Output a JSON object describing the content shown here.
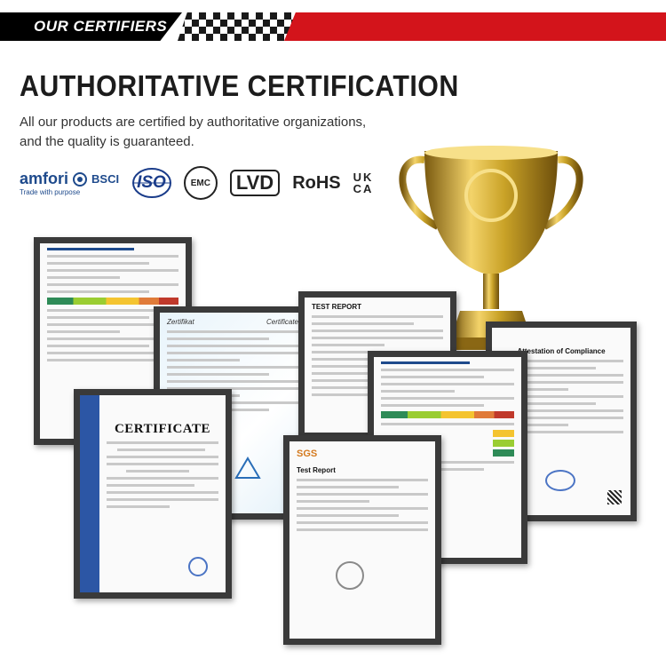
{
  "banner": {
    "title": "OUR CERTIFIERS"
  },
  "heading": {
    "title": "AUTHORITATIVE CERTIFICATION"
  },
  "intro": {
    "line1": "All our products are certified by authoritative organizations,",
    "line2": "and the quality is guaranteed."
  },
  "logos": {
    "amfori": "amfori",
    "amfori_bsci": "BSCI",
    "amfori_tagline": "Trade with purpose",
    "iso": "ISO",
    "emc": "EMC",
    "lvd": "LVD",
    "rohs": "RoHS",
    "ukca_top": "UK",
    "ukca_bottom": "CA"
  },
  "certificates": {
    "certificate_title": "CERTIFICATE",
    "sgs": "SGS",
    "zertifikat": "Zertifikat",
    "certificate_label": "Certificate",
    "attestation": "Attestation of Compliance",
    "test_report": "TEST REPORT",
    "test_report_2": "Test Report"
  },
  "colors": {
    "accent_red": "#d3141b",
    "banner_black": "#000000",
    "gold": "#c9a227",
    "frame": "#3a3a3a"
  }
}
